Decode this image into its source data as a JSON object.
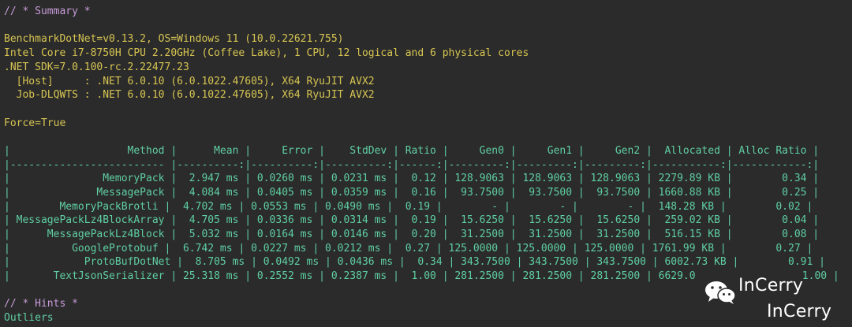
{
  "header": {
    "summary_comment": "// * Summary *"
  },
  "environment": {
    "line1": "BenchmarkDotNet=v0.13.2, OS=Windows 11 (10.0.22621.755)",
    "line2": "Intel Core i7-8750H CPU 2.20GHz (Coffee Lake), 1 CPU, 12 logical and 6 physical cores",
    "line3": ".NET SDK=7.0.100-rc.2.22477.23",
    "line4": "  [Host]     : .NET 6.0.10 (6.0.1022.47605), X64 RyuJIT AVX2",
    "line5": "  Job-DLQWTS : .NET 6.0.10 (6.0.1022.47605), X64 RyuJIT AVX2",
    "force": "Force=True"
  },
  "table": {
    "header": "|                   Method |      Mean |     Error |    StdDev | Ratio |     Gen0 |     Gen1 |     Gen2 |  Allocated | Alloc Ratio |",
    "separator": "|------------------------- |----------:|----------:|----------:|------:|---------:|---------:|---------:|-----------:|------------:|",
    "rows": [
      "|               MemoryPack |  2.947 ms | 0.0260 ms | 0.0231 ms |  0.12 | 128.9063 | 128.9063 | 128.9063 | 2279.89 KB |        0.34 |",
      "|              MessagePack |  4.084 ms | 0.0405 ms | 0.0359 ms |  0.16 |  93.7500 |  93.7500 |  93.7500 | 1660.88 KB |        0.25 |",
      "|        MemoryPackBrotli |  4.702 ms | 0.0553 ms | 0.0490 ms |  0.19 |        - |        - |        - |  148.28 KB |        0.02 |",
      "| MessagePackLz4BlockArray |  4.705 ms | 0.0336 ms | 0.0314 ms |  0.19 |  15.6250 |  15.6250 |  15.6250 |  259.02 KB |        0.04 |",
      "|      MessagePackLz4Block |  5.032 ms | 0.0164 ms | 0.0146 ms |  0.20 |  31.2500 |  31.2500 |  31.2500 |  516.15 KB |        0.08 |",
      "|          GoogleProtobuf |  6.742 ms | 0.0227 ms | 0.0212 ms |  0.27 | 125.0000 | 125.0000 | 125.0000 | 1761.99 KB |        0.27 |",
      "|            ProtoBufDotNet |  8.705 ms | 0.0492 ms | 0.0436 ms |  0.34 | 343.7500 | 343.7500 | 343.7500 | 6002.73 KB |        0.91 |",
      "|       TextJsonSerializer | 25.318 ms | 0.2552 ms | 0.2387 ms |  1.00 | 281.2500 | 281.2500 | 281.2500 | 6629.0",
      "       1.00 |"
    ]
  },
  "hints": {
    "comment": "// * Hints *",
    "outliers": "Outliers"
  },
  "watermark": {
    "line1": "InCerry",
    "line2": "InCerry",
    "icon": "wechat-icon"
  },
  "colors": {
    "background": "#2b2b2b",
    "comment": "#c79bd8",
    "environment": "#d7c552",
    "table": "#5fcfa4"
  }
}
